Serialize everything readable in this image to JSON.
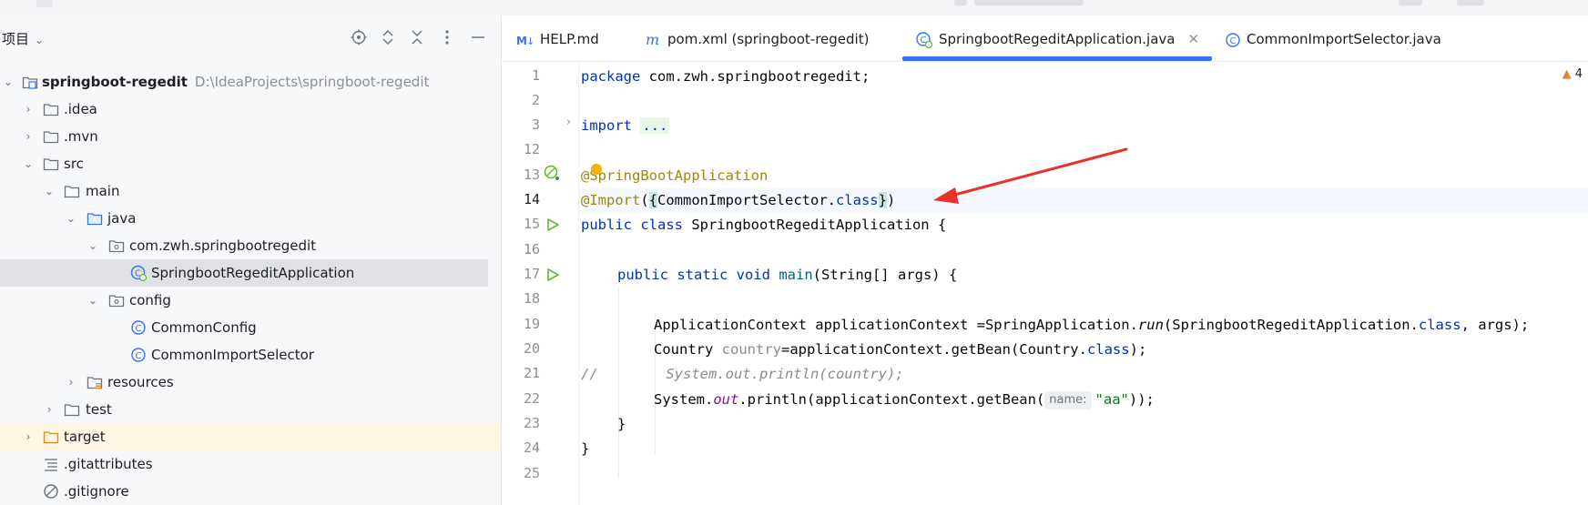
{
  "project_panel": {
    "title": "项目",
    "tree": [
      {
        "label": "springboot-regedit",
        "path": "D:\\IdeaProjects\\springboot-regedit",
        "depth": 0,
        "expanded": true,
        "icon": "module-folder-icon"
      },
      {
        "label": ".idea",
        "depth": 1,
        "expanded": false,
        "icon": "folder-icon"
      },
      {
        "label": ".mvn",
        "depth": 1,
        "expanded": false,
        "icon": "folder-icon"
      },
      {
        "label": "src",
        "depth": 1,
        "expanded": true,
        "icon": "folder-icon"
      },
      {
        "label": "main",
        "depth": 2,
        "expanded": true,
        "icon": "folder-icon"
      },
      {
        "label": "java",
        "depth": 3,
        "expanded": true,
        "icon": "source-folder-icon"
      },
      {
        "label": "com.zwh.springbootregedit",
        "depth": 4,
        "expanded": true,
        "icon": "package-icon"
      },
      {
        "label": "SpringbootRegeditApplication",
        "depth": 5,
        "icon": "spring-boot-class-icon",
        "selected": true
      },
      {
        "label": "config",
        "depth": 4,
        "expanded": true,
        "icon": "package-icon"
      },
      {
        "label": "CommonConfig",
        "depth": 5,
        "icon": "class-icon"
      },
      {
        "label": "CommonImportSelector",
        "depth": 5,
        "icon": "class-icon"
      },
      {
        "label": "resources",
        "depth": 3,
        "expanded": false,
        "icon": "resources-folder-icon"
      },
      {
        "label": "test",
        "depth": 2,
        "expanded": false,
        "icon": "folder-icon"
      },
      {
        "label": "target",
        "depth": 1,
        "expanded": false,
        "icon": "excluded-folder-icon",
        "excluded": true
      },
      {
        "label": ".gitattributes",
        "depth": 1,
        "icon": "text-file-icon"
      },
      {
        "label": ".gitignore",
        "depth": 1,
        "icon": "ignore-file-icon"
      }
    ]
  },
  "tabs": [
    {
      "label": "HELP.md",
      "icon": "markdown-icon"
    },
    {
      "label": "pom.xml (springboot-regedit)",
      "icon": "maven-icon"
    },
    {
      "label": "SpringbootRegeditApplication.java",
      "icon": "spring-boot-class-icon",
      "active": true
    },
    {
      "label": "CommonImportSelector.java",
      "icon": "class-icon"
    }
  ],
  "editor": {
    "warning_count": "4",
    "line_numbers": [
      "1",
      "2",
      "3",
      "12",
      "13",
      "14",
      "15",
      "16",
      "17",
      "18",
      "19",
      "20",
      "21",
      "22",
      "23",
      "24",
      "25"
    ],
    "code": {
      "l1_kw": "package",
      "l1_rest": " com.zwh.springbootregedit;",
      "l3_kw": "import",
      "l3_fold": "...",
      "l13_ann": "@SpringBootApplication",
      "l14_ann": "@Import",
      "l14_open": "(",
      "l14_brace_open": "{",
      "l14_cls": "CommonImportSelector.",
      "l14_kw": "class",
      "l14_brace_close": "}",
      "l14_close": ")",
      "l15_kw": "public class",
      "l15_rest": " SpringbootRegeditApplication {",
      "l17_kw": "public static void",
      "l17_mth": "main",
      "l17_rest": "(String[] args) {",
      "l19_a": "ApplicationContext applicationContext =SpringApplication.",
      "l19_run": "run",
      "l19_b": "(SpringbootRegeditApplication.",
      "l19_kw": "class",
      "l19_c": ", args);",
      "l20_a": "Country ",
      "l20_var": "country",
      "l20_b": "=applicationContext.getBean(Country.",
      "l20_kw": "class",
      "l20_c": ");",
      "l21_cmt": "//        System.out.println(country);",
      "l22_a": "System.",
      "l22_out": "out",
      "l22_b": ".println(applicationContext.getBean(",
      "l22_hint": "name:",
      "l22_str": "\"aa\"",
      "l22_c": "));",
      "l23": "}",
      "l24": "}"
    }
  },
  "annotation_arrow_color": "#e8322a",
  "accent": "#3574f0"
}
